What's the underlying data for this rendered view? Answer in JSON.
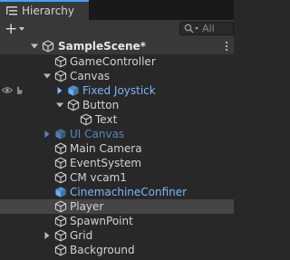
{
  "tab": {
    "title": "Hierarchy"
  },
  "toolbar": {
    "add_label": "+",
    "search_placeholder": "All"
  },
  "scene": {
    "name": "SampleScene*"
  },
  "tree": [
    {
      "label": "GameController",
      "depth": 1,
      "expander": "none",
      "kind": "go"
    },
    {
      "label": "Canvas",
      "depth": 1,
      "expander": "open",
      "kind": "go"
    },
    {
      "label": "Fixed Joystick",
      "depth": 2,
      "expander": "closed",
      "kind": "prefab"
    },
    {
      "label": "Button",
      "depth": 2,
      "expander": "open",
      "kind": "go"
    },
    {
      "label": "Text",
      "depth": 3,
      "expander": "none",
      "kind": "go"
    },
    {
      "label": "UI Canvas",
      "depth": 1,
      "expander": "closed",
      "kind": "prefab-dim"
    },
    {
      "label": "Main Camera",
      "depth": 1,
      "expander": "none",
      "kind": "go"
    },
    {
      "label": "EventSystem",
      "depth": 1,
      "expander": "none",
      "kind": "go"
    },
    {
      "label": "CM vcam1",
      "depth": 1,
      "expander": "none",
      "kind": "go"
    },
    {
      "label": "CinemachineConfiner",
      "depth": 1,
      "expander": "none",
      "kind": "prefab"
    },
    {
      "label": "Player",
      "depth": 1,
      "expander": "none",
      "kind": "go"
    },
    {
      "label": "SpawnPoint",
      "depth": 1,
      "expander": "none",
      "kind": "go"
    },
    {
      "label": "Grid",
      "depth": 1,
      "expander": "closed",
      "kind": "go"
    },
    {
      "label": "Background",
      "depth": 1,
      "expander": "none",
      "kind": "go"
    }
  ],
  "colors": {
    "accent": "#46a0f5",
    "prefab": "#7cb7f5",
    "prefab_dim": "#5a86b5",
    "background": "#282828"
  }
}
